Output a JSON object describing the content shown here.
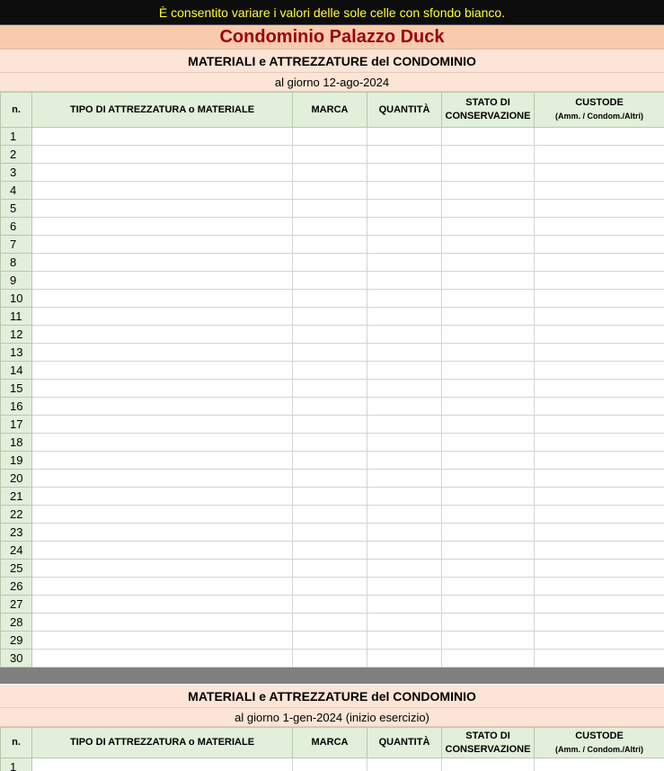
{
  "banner": "È consentito variare i valori delle sole celle con sfondo bianco.",
  "title": "Condominio Palazzo Duck",
  "section1": {
    "subtitle": "MATERIALI e ATTREZZATURE del CONDOMINIO",
    "date": "al giorno 12-ago-2024",
    "rows": [
      "1",
      "2",
      "3",
      "4",
      "5",
      "6",
      "7",
      "8",
      "9",
      "10",
      "11",
      "12",
      "13",
      "14",
      "15",
      "16",
      "17",
      "18",
      "19",
      "20",
      "21",
      "22",
      "23",
      "24",
      "25",
      "26",
      "27",
      "28",
      "29",
      "30"
    ]
  },
  "section2": {
    "subtitle": "MATERIALI e ATTREZZATURE del CONDOMINIO",
    "date": "al giorno 1-gen-2024 (inizio esercizio)",
    "rows": [
      "1",
      ""
    ]
  },
  "columns": {
    "n": "n.",
    "tipo": "TIPO DI ATTREZZATURA o MATERIALE",
    "marca": "MARCA",
    "quantita": "QUANTITÀ",
    "stato_line1": "STATO DI",
    "stato_line2": "CONSERVAZIONE",
    "custode": "CUSTODE",
    "custode_note": "(Amm. / Condom./Altri)"
  },
  "colors": {
    "banner_bg": "#0d0d0d",
    "banner_text": "#ffff33",
    "title_bg": "#f8cbad",
    "title_text": "#9c0006",
    "band_bg": "#fce4d6",
    "header_bg": "#e2efda",
    "separator": "#7f7f7f"
  }
}
